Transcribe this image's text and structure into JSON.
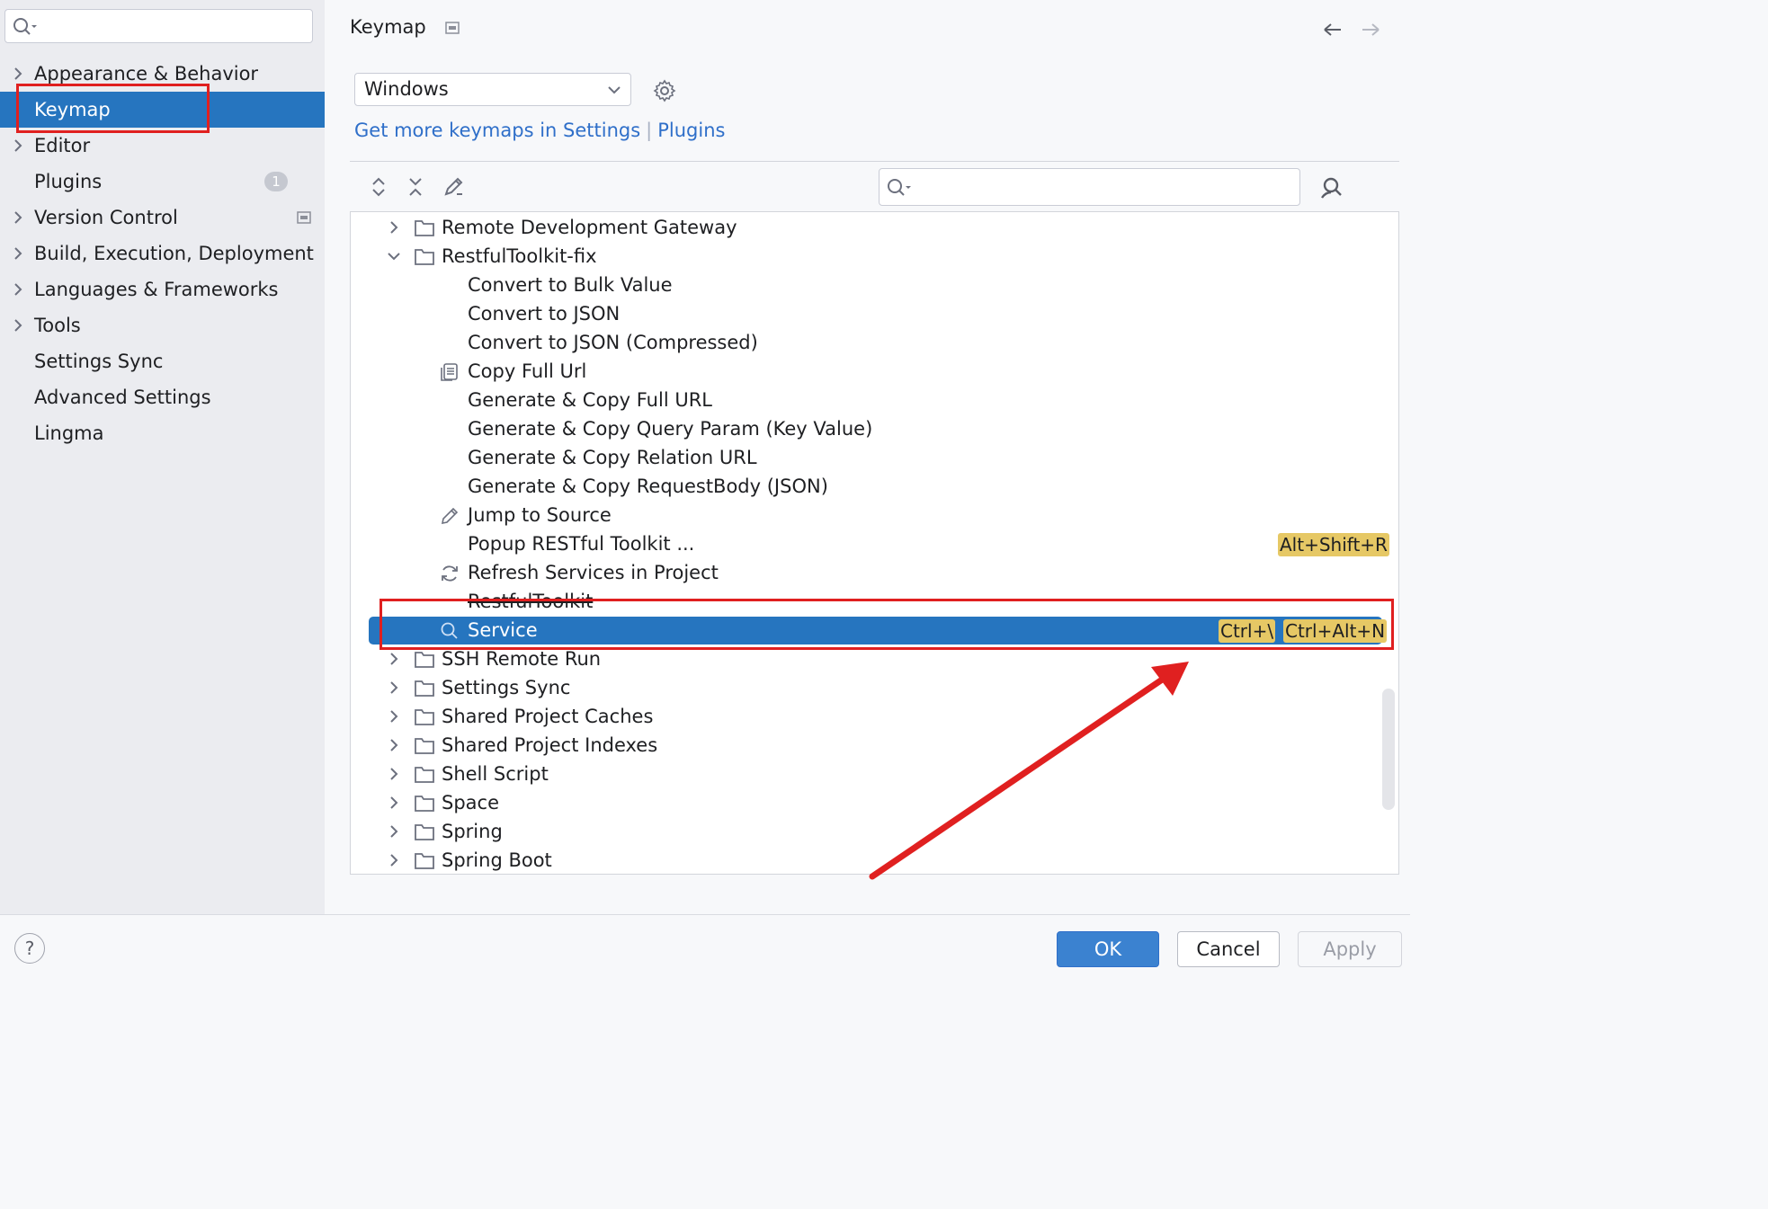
{
  "sidebar": {
    "search": {
      "placeholder": ""
    },
    "items": [
      {
        "label": "Appearance & Behavior"
      },
      {
        "label": "Keymap"
      },
      {
        "label": "Editor"
      },
      {
        "label": "Plugins",
        "badge": "1"
      },
      {
        "label": "Version Control"
      },
      {
        "label": "Build, Execution, Deployment"
      },
      {
        "label": "Languages & Frameworks"
      },
      {
        "label": "Tools"
      },
      {
        "label": "Settings Sync"
      },
      {
        "label": "Advanced Settings"
      },
      {
        "label": "Lingma"
      }
    ]
  },
  "main": {
    "title": "Keymap",
    "keymap_select": {
      "value": "Windows"
    },
    "links": {
      "text1": "Get more keymaps in Settings",
      "separator": "|",
      "text2": "Plugins"
    },
    "tree": [
      {
        "label": "Remote Development Gateway"
      },
      {
        "label": "RestfulToolkit-fix"
      },
      {
        "label": "Convert to Bulk Value"
      },
      {
        "label": "Convert to JSON"
      },
      {
        "label": "Convert to JSON (Compressed)"
      },
      {
        "label": "Copy Full Url"
      },
      {
        "label": "Generate & Copy Full URL"
      },
      {
        "label": "Generate & Copy Query Param (Key Value)"
      },
      {
        "label": "Generate & Copy Relation URL"
      },
      {
        "label": "Generate & Copy RequestBody (JSON)"
      },
      {
        "label": "Jump to Source"
      },
      {
        "label": "Popup RESTful Toolkit ...",
        "shortcut1": "Alt+Shift+R"
      },
      {
        "label": "Refresh Services in Project"
      },
      {
        "label": "RestfulToolkit"
      },
      {
        "label": "Service",
        "shortcut1": "Ctrl+\\",
        "shortcut2": "Ctrl+Alt+N"
      },
      {
        "label": "SSH Remote Run"
      },
      {
        "label": "Settings Sync"
      },
      {
        "label": "Shared Project Caches"
      },
      {
        "label": "Shared Project Indexes"
      },
      {
        "label": "Shell Script"
      },
      {
        "label": "Space"
      },
      {
        "label": "Spring"
      },
      {
        "label": "Spring Boot"
      }
    ]
  },
  "footer": {
    "help": "?",
    "ok": "OK",
    "cancel": "Cancel",
    "apply": "Apply"
  },
  "colors": {
    "accent": "#2675bf",
    "link": "#2f6fc9",
    "shortcut_bg": "#e6c865",
    "annotation": "#e02020"
  }
}
